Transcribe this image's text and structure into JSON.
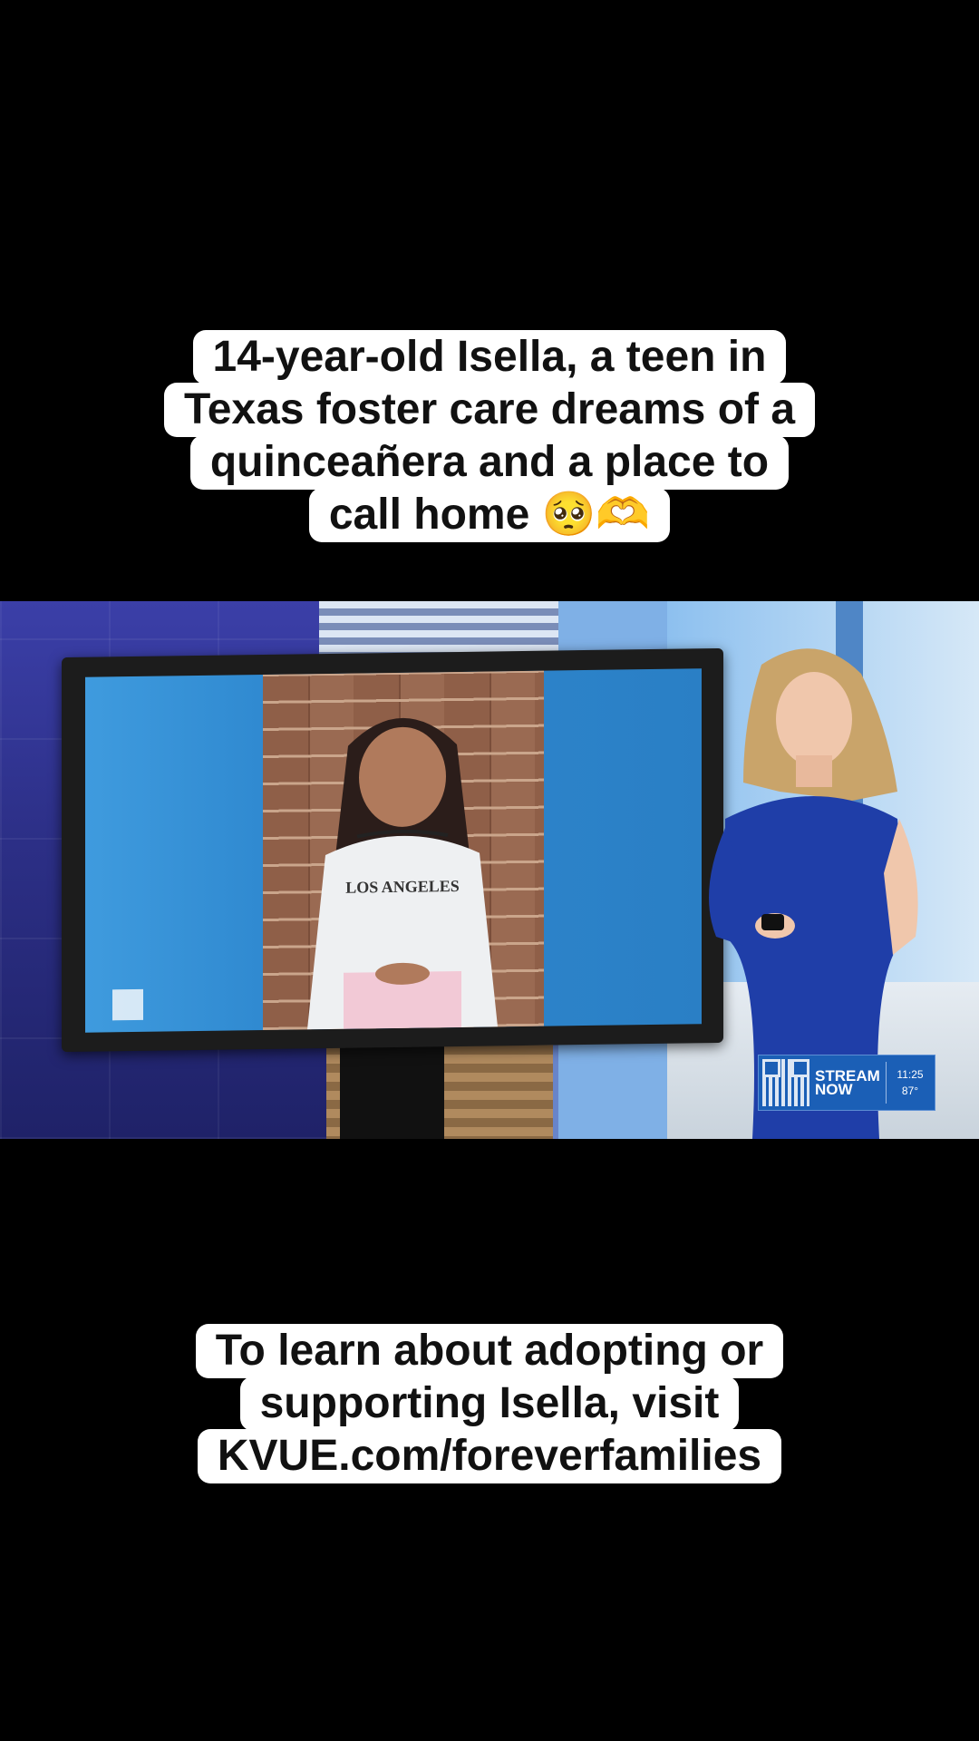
{
  "top_caption": {
    "lines": [
      "14-year-old Isella, a teen in",
      "Texas foster care dreams of a",
      "quinceañera and a place to",
      "call home 🥺🫶"
    ]
  },
  "video": {
    "monitor_photo_shirt_text": "LOS ANGELES",
    "badge": {
      "label_line1": "STREAM",
      "label_line2": "NOW",
      "time": "11:25",
      "temperature": "87°",
      "qr_icon": "qr-code-icon"
    },
    "colors": {
      "studio_blue": "#3b3fa8",
      "dress_blue": "#1f3ea8",
      "badge_blue": "#1b5fb6"
    }
  },
  "bottom_caption": {
    "lines": [
      "To learn about adopting or",
      "supporting Isella, visit",
      "KVUE.com/foreverfamilies"
    ]
  }
}
